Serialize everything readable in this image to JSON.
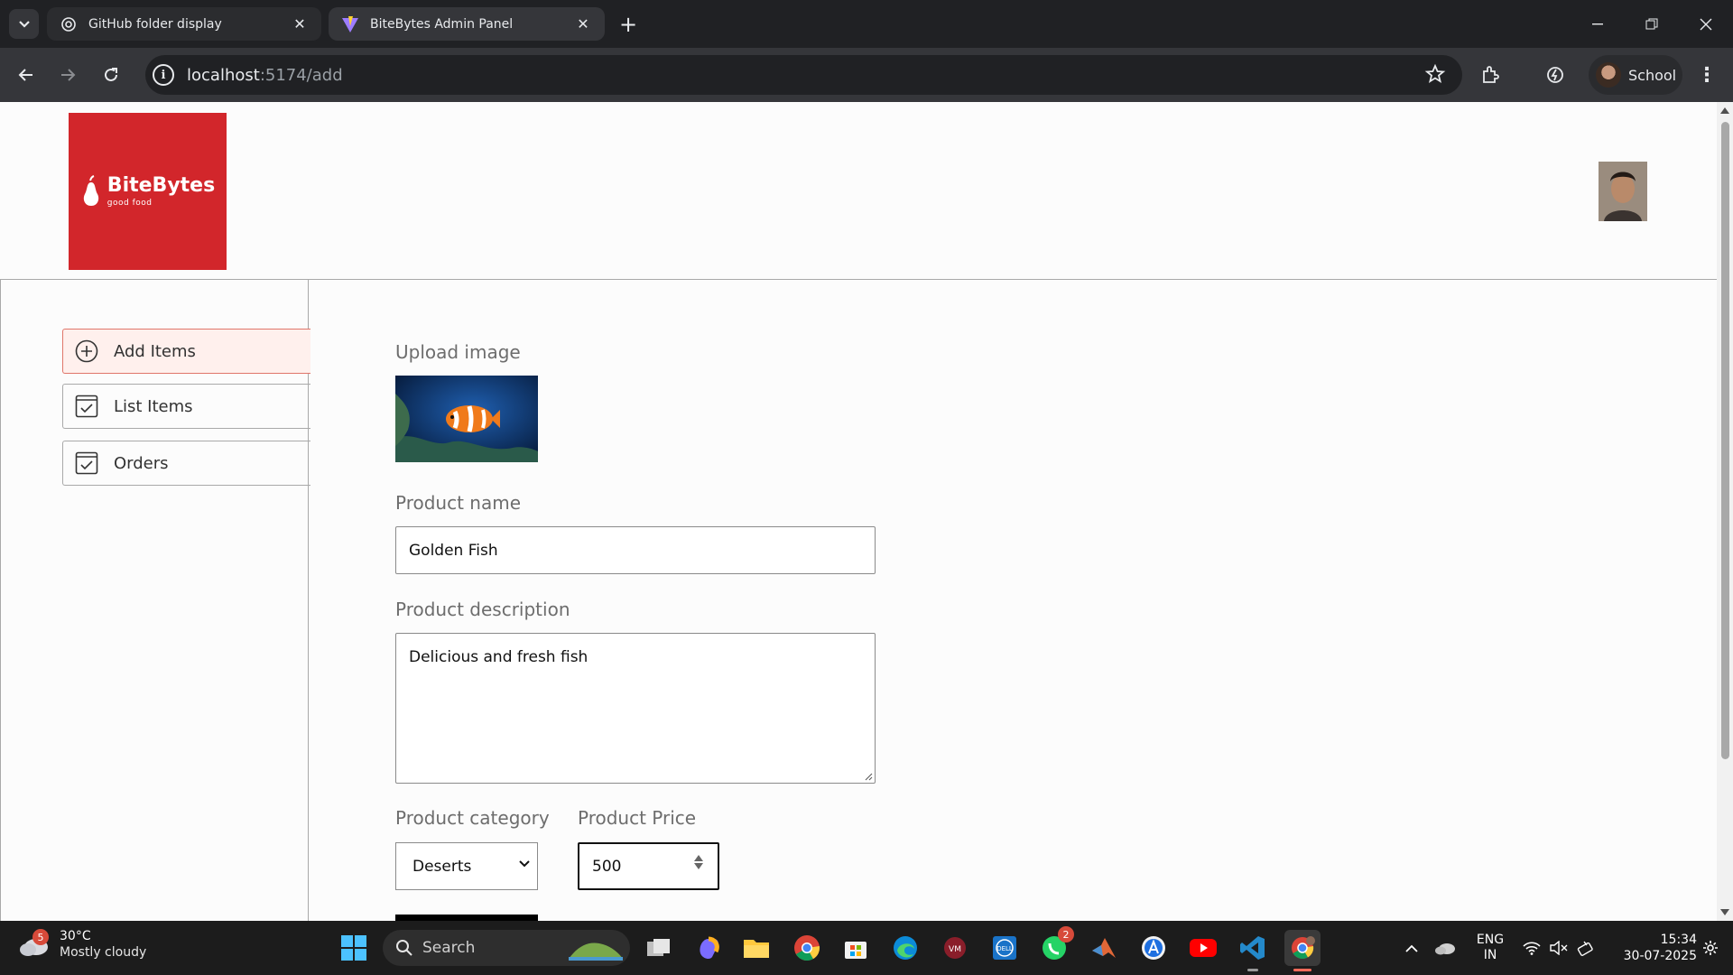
{
  "browser": {
    "tabs": [
      {
        "title": "GitHub folder display",
        "icon": "openai-icon",
        "active": false
      },
      {
        "title": "BiteBytes Admin Panel",
        "icon": "vite-icon",
        "active": true
      }
    ],
    "url_host": "localhost",
    "url_path": ":5174/add",
    "profile_name": "School"
  },
  "app": {
    "brand": "BiteBytes",
    "tagline": "good food",
    "brand_color": "#d2262b"
  },
  "sidebar": {
    "items": [
      {
        "label": "Add Items",
        "icon": "add-circle-icon",
        "active": true
      },
      {
        "label": "List Items",
        "icon": "checkbox-icon",
        "active": false
      },
      {
        "label": "Orders",
        "icon": "checkbox-icon",
        "active": false
      }
    ]
  },
  "form": {
    "upload_label": "Upload image",
    "name_label": "Product name",
    "name_value": "Golden Fish",
    "description_label": "Product description",
    "description_value": "Delicious and fresh fish",
    "category_label": "Product category",
    "category_value": "Deserts",
    "price_label": "Product Price",
    "price_value": "500"
  },
  "taskbar": {
    "weather_temp": "30°C",
    "weather_condition": "Mostly cloudy",
    "weather_badge": "5",
    "search_placeholder": "Search",
    "whatsapp_badge": "2",
    "language_1": "ENG",
    "language_2": "IN",
    "time": "15:34",
    "date": "30-07-2025"
  }
}
